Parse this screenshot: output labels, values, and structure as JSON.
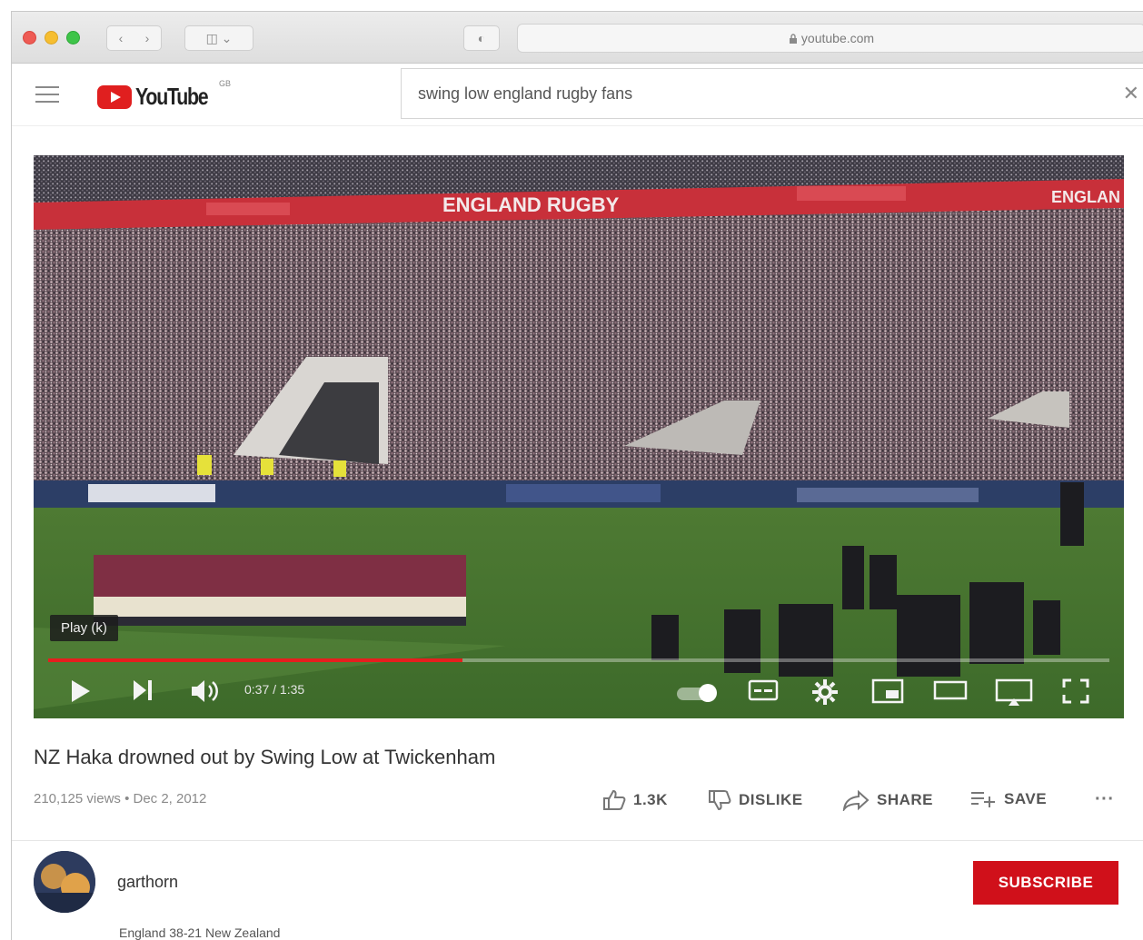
{
  "browser": {
    "url": "youtube.com",
    "nav_back": "‹",
    "nav_forward": "›",
    "sidebar_glyph": "◫ ⌄",
    "shield_glyph": "◐"
  },
  "header": {
    "logo_text": "YouTube",
    "logo_country": "GB",
    "search_value": "swing low england rugby fans",
    "clear_glyph": "✕"
  },
  "player": {
    "tooltip": "Play (k)",
    "time": "0:37 / 1:35",
    "progress_fraction": 0.39,
    "banner_text": "ENGLAND RUGBY",
    "banner_text_2": "ENGLAN"
  },
  "video": {
    "title": "NZ Haka drowned out by Swing Low at Twickenham",
    "meta": "210,125 views • Dec 2, 2012",
    "likes": "1.3K",
    "dislike_label": "DISLIKE",
    "share_label": "SHARE",
    "save_label": "SAVE",
    "more_glyph": "···"
  },
  "channel": {
    "name": "garthorn",
    "subscribe_label": "SUBSCRIBE",
    "description": "England 38-21 New Zealand"
  },
  "colors": {
    "brand_red": "#e01f1f",
    "subscribe_red": "#d0101a",
    "progress_red": "#e61e1e"
  }
}
